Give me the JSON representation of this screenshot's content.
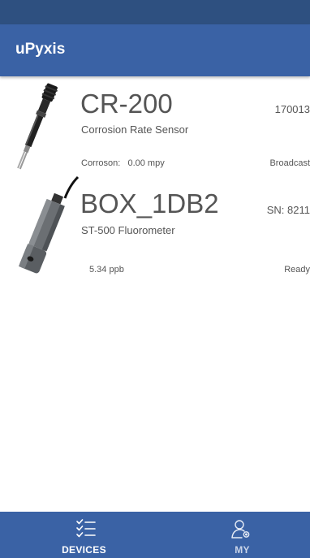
{
  "app": {
    "title": "uPyxis"
  },
  "devices": [
    {
      "name": "CR-200",
      "type": "Corrosion Rate Sensor",
      "serial": "170013",
      "reading": "Corroson:   0.00 mpy",
      "status": "Broadcast",
      "icon": "corrosion-probe-image"
    },
    {
      "name": "BOX_1DB2",
      "type": "ST-500 Fluorometer",
      "serial": "SN: 8211",
      "reading": "5.34 ppb",
      "status": "Ready",
      "icon": "fluorometer-probe-image"
    }
  ],
  "bottom_nav": {
    "tabs": [
      {
        "label": "DEVICES",
        "icon": "checklist-icon",
        "active": true
      },
      {
        "label": "MY",
        "icon": "user-settings-icon",
        "active": false
      }
    ]
  },
  "colors": {
    "status_bar": "#2e5080",
    "app_bar": "#3a62a5",
    "bottom_nav": "#3a62a5",
    "text": "#555555"
  }
}
